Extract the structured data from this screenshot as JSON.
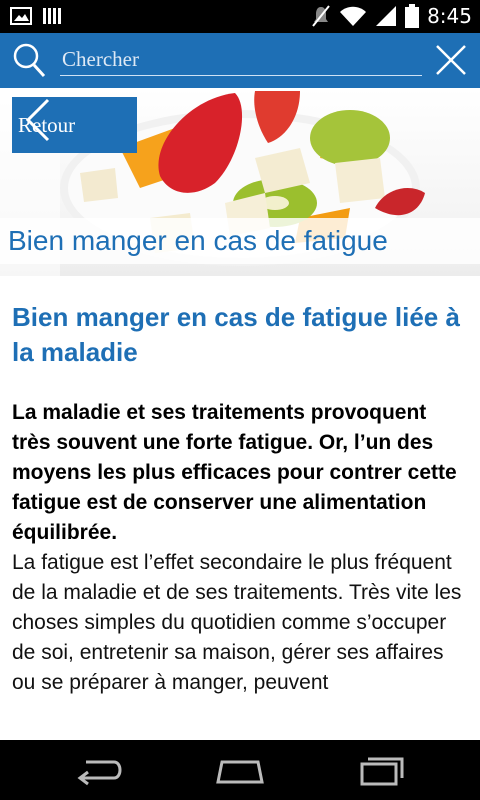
{
  "status_bar": {
    "time": "8:45",
    "icons_left": [
      "image-icon",
      "bars-icon"
    ],
    "icons_right": [
      "mute-icon",
      "wifi-icon",
      "signal-icon",
      "battery-icon"
    ]
  },
  "search": {
    "placeholder": "Chercher",
    "value": ""
  },
  "hero": {
    "back_label": "Retour",
    "title": "Bien manger en cas de fatigue"
  },
  "article": {
    "title": "Bien manger en cas de fatigue liée à la maladie",
    "lead": "La maladie et ses traitements provoquent très souvent une forte fatigue. Or, l’un des moyens les plus efficaces pour contrer cette fatigue est de conserver une alimentation équilibrée.",
    "body": "La fatigue est l’effet secondaire le plus fréquent de la maladie et de ses traitements. Très vite les choses simples du quotidien comme s’occuper de soi, entretenir sa maison, gérer ses affaires ou se préparer à manger, peuvent"
  },
  "nav": {
    "buttons": [
      "back-nav-icon",
      "home-nav-icon",
      "recents-nav-icon"
    ]
  },
  "colors": {
    "accent": "#1e6fb5",
    "status_bar": "#000000"
  }
}
